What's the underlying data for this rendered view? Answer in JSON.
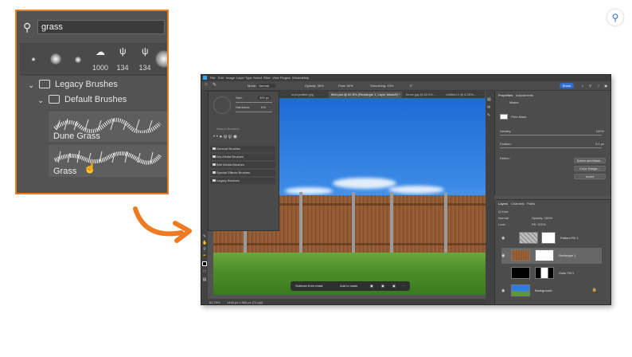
{
  "callout": {
    "search_value": "grass",
    "presets": [
      "",
      "",
      "",
      "1000",
      "134",
      "134",
      ""
    ],
    "group_legacy": "Legacy Brushes",
    "group_default": "Default Brushes",
    "brushes": [
      "Dune Grass",
      "Grass"
    ]
  },
  "accent_color": "#f07a22",
  "ps": {
    "menu": [
      "File",
      "Edit",
      "Image",
      "Layer",
      "Type",
      "Select",
      "Filter",
      "View",
      "Plugins",
      "Window",
      "Help"
    ],
    "options": {
      "mode_label": "Mode:",
      "mode_value": "Normal",
      "opacity": "Opacity: 35%",
      "flow": "Flow: 50%",
      "smoothing": "Smoothing: 10%",
      "angle": "0°",
      "share": "Share"
    },
    "tabs": [
      "mod-pattern.jpg",
      "field.psd @ 62.8% (Rectangle 1, Layer Mask/8) *",
      "fence.jpg @ 62.5%...",
      "Untitled-1 @ 6.25%..."
    ],
    "brush_panel": {
      "size_label": "Size:",
      "size_value": "300 px",
      "hardness_label": "Hardness:",
      "hardness_value": "0%",
      "search_placeholder": "Search Brushes",
      "folders": [
        "General Brushes",
        "Dry Media Brushes",
        "Wet Media Brushes",
        "Special Effects Brushes",
        "Legacy Brushes"
      ]
    },
    "taskbar": {
      "subtract": "Subtract from mask",
      "add": "Add to mask"
    },
    "status": {
      "zoom": "62.79%",
      "dims": "1440 px x 960 px (72 ppi)"
    },
    "properties": {
      "tabs": [
        "Properties",
        "Adjustments"
      ],
      "section": "Masks",
      "mask_label": "Pixel Mask",
      "density_label": "Density:",
      "density_value": "100%",
      "feather_label": "Feather:",
      "feather_value": "0.0 px",
      "refine_label": "Refine:",
      "buttons": [
        "Select and Mask...",
        "Color Range...",
        "Invert"
      ]
    },
    "layers": {
      "tabs": [
        "Layers",
        "Channels",
        "Paths"
      ],
      "kind": "Q Kind",
      "blend": "Normal",
      "opacity": "Opacity: 100%",
      "lock": "Lock:",
      "fill": "Fill: 100%",
      "items": [
        "Pattern Fill 1",
        "Rectangle 1",
        "Color Fill 1",
        "Background"
      ]
    }
  }
}
